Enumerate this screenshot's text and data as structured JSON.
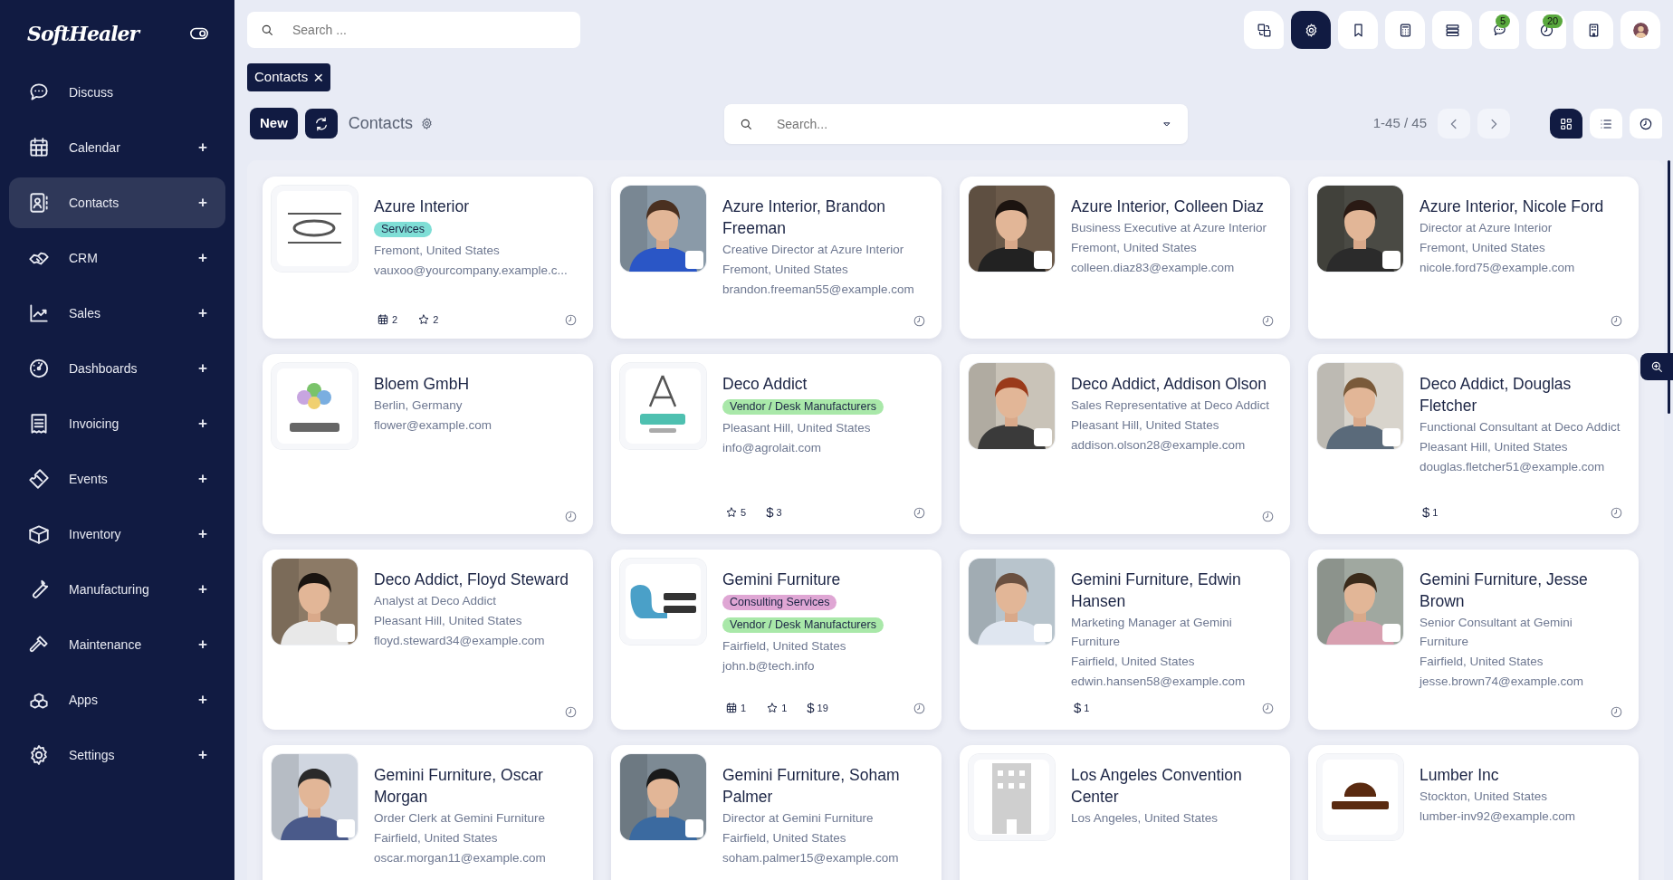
{
  "brand": {
    "name": "SoftHealer"
  },
  "sidebar": {
    "items": [
      {
        "label": "Discuss",
        "selected": false
      },
      {
        "label": "Calendar",
        "selected": false,
        "expander": "+"
      },
      {
        "label": "Contacts",
        "selected": true,
        "expander": "+"
      },
      {
        "label": "CRM",
        "selected": false,
        "expander": "+"
      },
      {
        "label": "Sales",
        "selected": false,
        "expander": "+"
      },
      {
        "label": "Dashboards",
        "selected": false,
        "expander": "+"
      },
      {
        "label": "Invoicing",
        "selected": false,
        "expander": "+"
      },
      {
        "label": "Events",
        "selected": false,
        "expander": "+"
      },
      {
        "label": "Inventory",
        "selected": false,
        "expander": "+"
      },
      {
        "label": "Manufacturing",
        "selected": false,
        "expander": "+"
      },
      {
        "label": "Maintenance",
        "selected": false,
        "expander": "+"
      },
      {
        "label": "Apps",
        "selected": false,
        "expander": "+"
      },
      {
        "label": "Settings",
        "selected": false,
        "expander": "+"
      }
    ]
  },
  "topbar": {
    "search": {
      "placeholder": "Search ..."
    },
    "icons": [
      {
        "selected": false
      },
      {
        "selected": true
      },
      {
        "selected": false
      },
      {
        "selected": false
      },
      {
        "selected": false
      },
      {
        "selected": false,
        "badge": "5"
      },
      {
        "selected": false,
        "badge": "20"
      },
      {
        "selected": false
      },
      {
        "selected": false
      }
    ]
  },
  "breadcrumb": [
    {
      "label": "Contacts",
      "close": "×"
    }
  ],
  "control_panel": {
    "new_button": "New",
    "title": "Contacts",
    "search": {
      "placeholder": "Search..."
    },
    "pager": "1-45 / 45",
    "views": [
      {
        "selected": true
      },
      {
        "selected": false
      },
      {
        "selected": false
      }
    ]
  },
  "cards": [
    {
      "name": "Azure Interior",
      "tags": [
        {
          "label": "Services",
          "color": "#7fded6"
        }
      ],
      "location": "Fremont, United States",
      "email": "vauxoo@yourcompany.example.c...",
      "footer": [
        {
          "kind": "calendar",
          "count": "2"
        },
        {
          "kind": "star",
          "count": "2"
        },
        {
          "kind": "activity"
        }
      ]
    },
    {
      "name": "Azure Interior, Brandon Freeman",
      "job": "Creative Director at Azure Interior",
      "location": "Fremont, United States",
      "email": "brandon.freeman55@example.com",
      "footer": [
        {
          "kind": "activity"
        }
      ]
    },
    {
      "name": "Azure Interior, Colleen Diaz",
      "job": "Business Executive at Azure Interior",
      "location": "Fremont, United States",
      "email": "colleen.diaz83@example.com",
      "footer": [
        {
          "kind": "activity"
        }
      ]
    },
    {
      "name": "Azure Interior, Nicole Ford",
      "job": "Director at Azure Interior",
      "location": "Fremont, United States",
      "email": "nicole.ford75@example.com",
      "footer": [
        {
          "kind": "activity"
        }
      ]
    },
    {
      "name": "Bloem GmbH",
      "location": "Berlin, Germany",
      "email": "flower@example.com",
      "footer": [
        {
          "kind": "activity"
        }
      ]
    },
    {
      "name": "Deco Addict",
      "tags": [
        {
          "label": "Vendor / Desk Manufacturers",
          "color": "#a9e8a9"
        }
      ],
      "location": "Pleasant Hill, United States",
      "email": "info@agrolait.com",
      "footer": [
        {
          "kind": "star",
          "count": "5"
        },
        {
          "kind": "sale",
          "glyph": "$",
          "count": "3"
        },
        {
          "kind": "activity"
        }
      ]
    },
    {
      "name": "Deco Addict, Addison Olson",
      "job": "Sales Representative at Deco Addict",
      "location": "Pleasant Hill, United States",
      "email": "addison.olson28@example.com",
      "footer": [
        {
          "kind": "activity"
        }
      ]
    },
    {
      "name": "Deco Addict, Douglas Fletcher",
      "job": "Functional Consultant at Deco Addict",
      "location": "Pleasant Hill, United States",
      "email": "douglas.fletcher51@example.com",
      "footer": [
        {
          "kind": "sale",
          "glyph": "$",
          "count": "1"
        },
        {
          "kind": "activity"
        }
      ]
    },
    {
      "name": "Deco Addict, Floyd Steward",
      "job": "Analyst at Deco Addict",
      "location": "Pleasant Hill, United States",
      "email": "floyd.steward34@example.com",
      "footer": [
        {
          "kind": "activity"
        }
      ]
    },
    {
      "name": "Gemini Furniture",
      "tags": [
        {
          "label": "Consulting Services",
          "color": "#dfa6d4"
        },
        {
          "label": "Vendor / Desk Manufacturers",
          "color": "#a9e8a9"
        }
      ],
      "location": "Fairfield, United States",
      "email": "john.b@tech.info",
      "footer": [
        {
          "kind": "calendar",
          "count": "1"
        },
        {
          "kind": "star",
          "count": "1"
        },
        {
          "kind": "sale",
          "glyph": "$",
          "count": "19"
        },
        {
          "kind": "activity"
        }
      ]
    },
    {
      "name": "Gemini Furniture, Edwin Hansen",
      "job": "Marketing Manager at Gemini Furniture",
      "location": "Fairfield, United States",
      "email": "edwin.hansen58@example.com",
      "footer": [
        {
          "kind": "sale",
          "glyph": "$",
          "count": "1"
        },
        {
          "kind": "activity"
        }
      ]
    },
    {
      "name": "Gemini Furniture, Jesse Brown",
      "job": "Senior Consultant at Gemini Furniture",
      "location": "Fairfield, United States",
      "email": "jesse.brown74@example.com",
      "footer": [
        {
          "kind": "activity"
        }
      ]
    },
    {
      "name": "Gemini Furniture, Oscar Morgan",
      "job": "Order Clerk at Gemini Furniture",
      "location": "Fairfield, United States",
      "email": "oscar.morgan11@example.com"
    },
    {
      "name": "Gemini Furniture, Soham Palmer",
      "job": "Director at Gemini Furniture",
      "location": "Fairfield, United States",
      "email": "soham.palmer15@example.com"
    },
    {
      "name": "Los Angeles Convention Center",
      "location": "Los Angeles, United States"
    },
    {
      "name": "Lumber Inc",
      "location": "Stockton, United States",
      "email": "lumber-inv92@example.com"
    }
  ]
}
